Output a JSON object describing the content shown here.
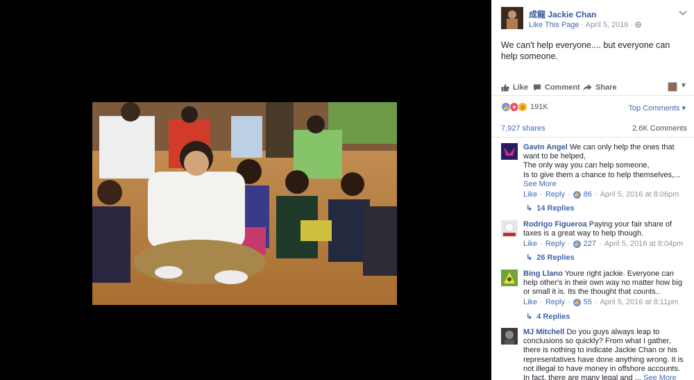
{
  "post": {
    "page_name": "成龍 Jackie Chan",
    "like_page": "Like This Page",
    "date": "April 5, 2016",
    "text": "We can't help everyone.... but everyone can help someone."
  },
  "actions": {
    "like": "Like",
    "comment": "Comment",
    "share": "Share"
  },
  "reactions": {
    "count": "191K",
    "sort_label": "Top Comments",
    "shares": "7,927 shares",
    "comments": "2.6K Comments"
  },
  "comments": [
    {
      "name": "Gavin Angel",
      "lines": [
        "We can only help the ones that want to be helped,",
        "The only way you can help someone,",
        "Is to give them a chance to help themselves,... "
      ],
      "see_more": "See More",
      "like": "Like",
      "reply": "Reply",
      "likes": "86",
      "time": "April 5, 2016 at 8:06pm",
      "replies": "14 Replies"
    },
    {
      "name": "Rodrigo Figueroa",
      "lines": [
        "Paying your fair share of taxes is a great way to help though."
      ],
      "like": "Like",
      "reply": "Reply",
      "likes": "227",
      "time": "April 5, 2016 at 8:04pm",
      "replies": "26 Replies"
    },
    {
      "name": "Bing Llano",
      "lines": [
        "Youre right jackie. Everyone can help other's in their own way no matter how big or small it is. Its the thought that counts.."
      ],
      "like": "Like",
      "reply": "Reply",
      "likes": "55",
      "time": "April 5, 2016 at 8:11pm",
      "replies": "4 Replies"
    },
    {
      "name": "MJ Mitchell",
      "lines": [
        "Do you guys always leap to conclusions so quickly? From what I gather, there is nothing to indicate Jackie Chan or his representatives have done anything wrong. It is not illegal to have money in offshore accounts. In fact, there are many legal and ... "
      ],
      "see_more": "See More"
    }
  ],
  "colors": {
    "link": "#365899",
    "accent": "#4267b2",
    "muted": "#90949c",
    "like_blue": "#5890ff"
  }
}
